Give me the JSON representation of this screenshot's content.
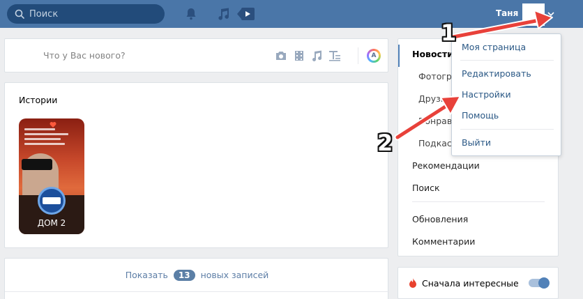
{
  "header": {
    "search_placeholder": "Поиск",
    "user_name": "Таня",
    "icons": [
      "bell-icon",
      "music-icon",
      "play-icon"
    ]
  },
  "post_box": {
    "placeholder": "Что у Вас нового?",
    "avatar_letter": "A"
  },
  "stories": {
    "title": "Истории",
    "items": [
      {
        "label": "ДОМ 2"
      }
    ]
  },
  "feed": {
    "show_prefix": "Показать",
    "new_count": "13",
    "show_suffix": "новых записей"
  },
  "side_menu": {
    "items": [
      {
        "label": "Новости"
      },
      {
        "label": "Фотографии"
      },
      {
        "label": "Друзья"
      },
      {
        "label": "Понравилось"
      },
      {
        "label": "Подкасты"
      },
      {
        "label": "Рекомендации"
      },
      {
        "label": "Поиск"
      },
      {
        "label": "Обновления"
      },
      {
        "label": "Комментарии"
      }
    ]
  },
  "interesting": {
    "label": "Сначала интересные",
    "enabled": true
  },
  "dropdown": {
    "items": [
      {
        "label": "Моя страница"
      },
      {
        "label": "Редактировать"
      },
      {
        "label": "Настройки"
      },
      {
        "label": "Помощь"
      },
      {
        "label": "Выйти"
      }
    ]
  },
  "annotations": {
    "step1": "1",
    "step2": "2",
    "arrow_color": "#e8413a"
  },
  "colors": {
    "header": "#4a76a8",
    "link": "#2a5885",
    "accent": "#5181b8"
  }
}
